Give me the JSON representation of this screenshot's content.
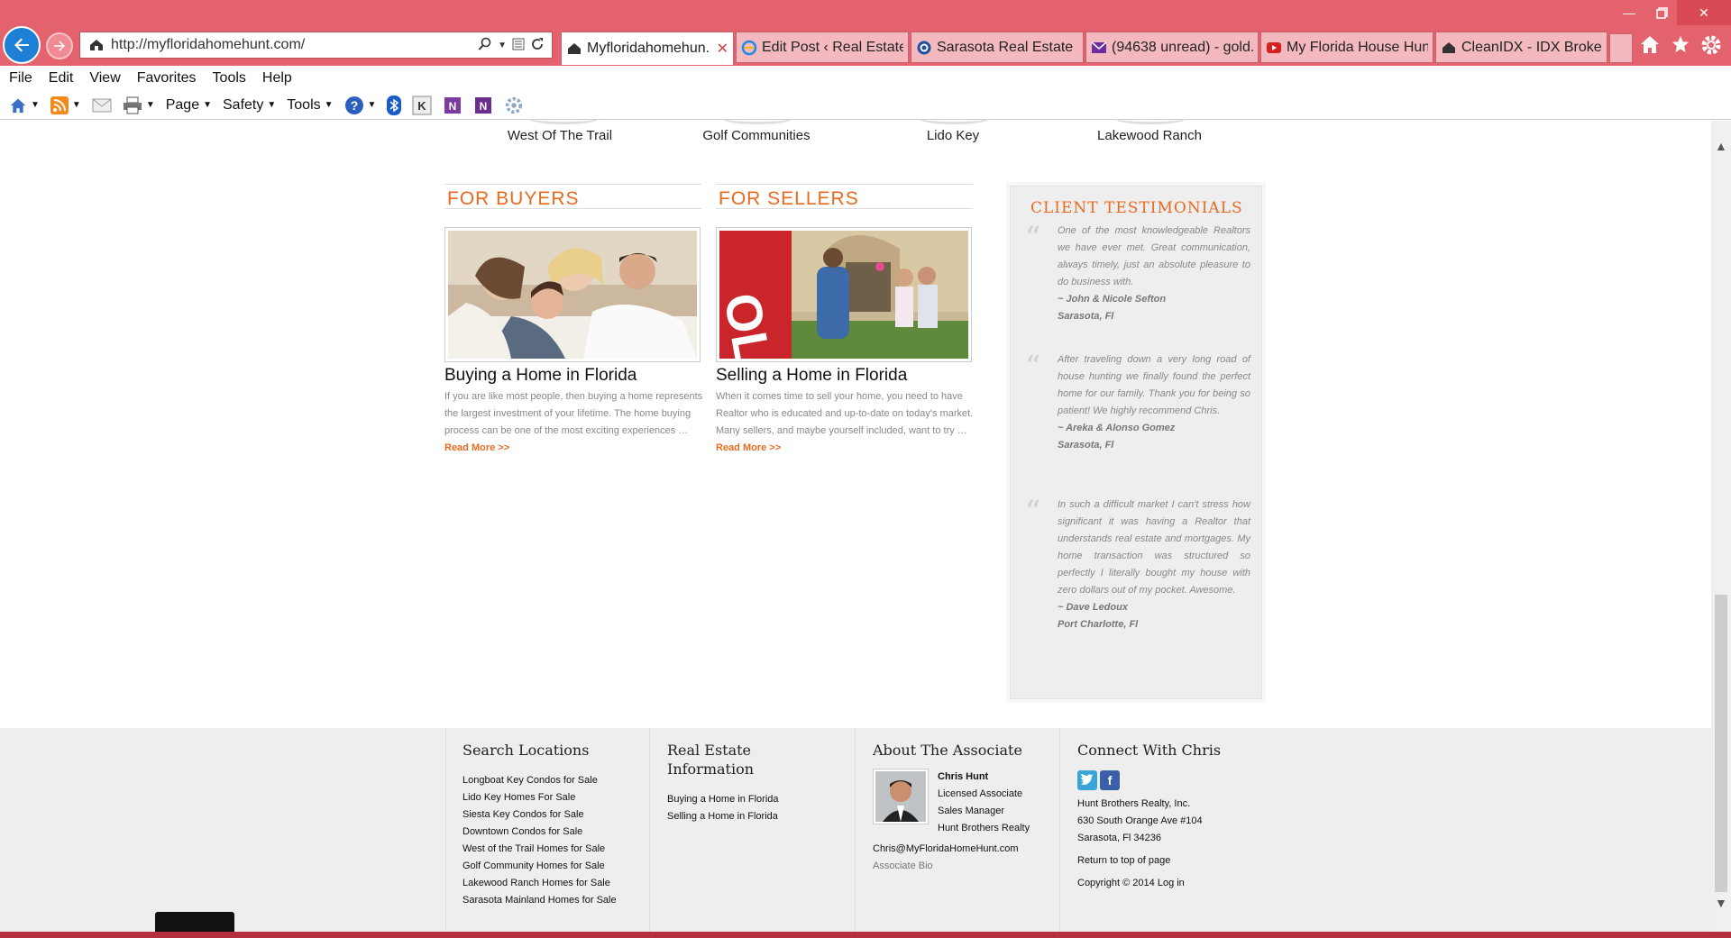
{
  "browser": {
    "url": "http://myfloridahomehunt.com/",
    "tabs": [
      {
        "label": "Myfloridahomehun...",
        "icon": "house-favicon",
        "active": true
      },
      {
        "label": "Edit Post ‹ Real Estate ...",
        "icon": "ie-icon"
      },
      {
        "label": "Sarasota Real Estate | ...",
        "icon": "globe-favicon"
      },
      {
        "label": "(94638 unread) - gold...",
        "icon": "yahoo-mail-icon"
      },
      {
        "label": "My Florida House Hun...",
        "icon": "youtube-icon"
      },
      {
        "label": "CleanIDX - IDX Broker...",
        "icon": "house-favicon"
      }
    ],
    "menu": [
      "File",
      "Edit",
      "View",
      "Favorites",
      "Tools",
      "Help"
    ],
    "commands": {
      "page": "Page",
      "safety": "Safety",
      "tools": "Tools"
    }
  },
  "locations": [
    "West Of The Trail",
    "Golf Communities",
    "Lido Key",
    "Lakewood Ranch"
  ],
  "buyers": {
    "heading": "FOR BUYERS",
    "title": "Buying a Home in Florida",
    "body": "If you are like most people, then buying a home represents the largest investment of your lifetime. The home buying process can be one of the most exciting experiences …",
    "read_more": "Read More >>"
  },
  "sellers": {
    "heading": "FOR SELLERS",
    "title": "Selling a Home in Florida",
    "body": "When it comes time to sell your home, you need to have Realtor who is educated and up-to-date on today's market. Many sellers, and maybe yourself included, want to try …",
    "read_more": "Read More >>"
  },
  "testimonials": {
    "heading": "CLIENT TESTIMONIALS",
    "items": [
      {
        "text": "One of the most knowledgeable Realtors we have ever met. Great communication, always timely, just an absolute pleasure to do business with.",
        "author": "~ John & Nicole Sefton",
        "place": "Sarasota, Fl"
      },
      {
        "text": "After traveling down a very long road of house hunting we finally found the perfect home for our family. Thank you for being so patient! We highly recommend Chris.",
        "author": "~ Areka & Alonso Gomez",
        "place": "Sarasota, Fl"
      },
      {
        "text": "In such a difficult market I can't stress how significant it was having a Realtor that understands real estate and mortgages. My home transaction was structured so perfectly I literally bought my house with zero dollars out of my pocket. Awesome.",
        "author": "~ Dave Ledoux",
        "place": "Port Charlotte, Fl"
      }
    ]
  },
  "footer": {
    "search": {
      "heading": "Search Locations",
      "links": [
        "Longboat Key Condos for Sale",
        "Lido Key Homes For Sale",
        "Siesta Key Condos for Sale",
        "Downtown Condos for Sale",
        "West of the Trail Homes for Sale",
        "Golf Community Homes for Sale",
        "Lakewood Ranch Homes for Sale",
        "Sarasota Mainland Homes for Sale"
      ]
    },
    "info": {
      "heading": "Real Estate Information",
      "links": [
        "Buying a Home in Florida",
        "Selling a Home in Florida"
      ]
    },
    "about": {
      "heading": "About The Associate",
      "name": "Chris Hunt",
      "lines": [
        "Licensed Associate",
        "Sales Manager",
        "Hunt Brothers Realty"
      ],
      "email": "Chris@MyFloridaHomeHunt.com",
      "bio": "Associate Bio"
    },
    "connect": {
      "heading": "Connect With Chris",
      "company": "Hunt Brothers Realty, Inc.",
      "address1": "630 South Orange Ave #104",
      "address2": "Sarasota, Fl 34236",
      "top": "Return to top of page",
      "copyright": "Copyright © 2014",
      "login": "Log in"
    }
  }
}
